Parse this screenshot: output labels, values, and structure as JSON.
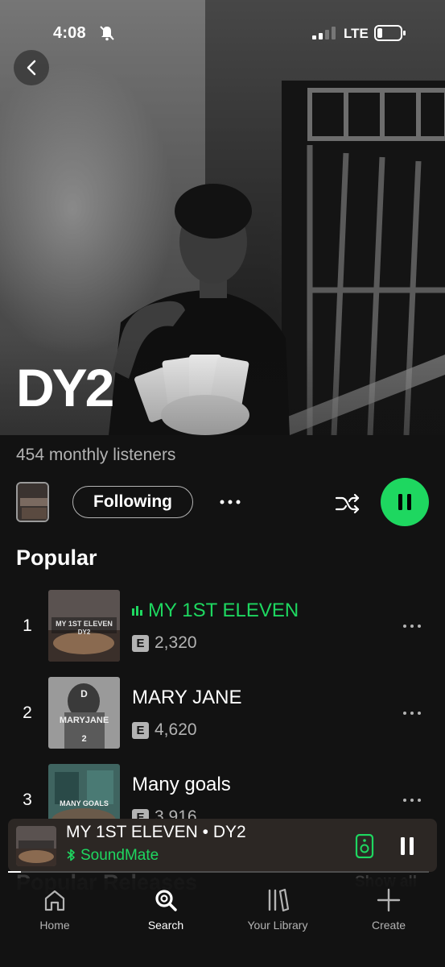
{
  "status_bar": {
    "time": "4:08",
    "network": "LTE"
  },
  "artist": {
    "name": "DY2",
    "monthly_listeners": "454 monthly listeners",
    "follow_label": "Following"
  },
  "popular": {
    "title": "Popular",
    "tracks": [
      {
        "number": "1",
        "title": "MY 1ST ELEVEN",
        "explicit": "E",
        "plays": "2,320",
        "playing": true,
        "cover_text": "MY 1ST ELEVEN DY2"
      },
      {
        "number": "2",
        "title": "MARY JANE",
        "explicit": "E",
        "plays": "4,620",
        "playing": false,
        "cover_text": "D MARYJANE 2"
      },
      {
        "number": "3",
        "title": "Many goals",
        "explicit": "E",
        "plays": "3,916",
        "playing": false,
        "cover_text": "MANY GOALS"
      }
    ]
  },
  "popular_releases": {
    "title": "Popular Releases",
    "show_all": "Show all"
  },
  "mini_player": {
    "title": "MY 1ST ELEVEN • DY2",
    "device": "SoundMate",
    "progress": 0.03
  },
  "nav": {
    "items": [
      {
        "label": "Home",
        "icon": "home-icon"
      },
      {
        "label": "Search",
        "icon": "search-icon",
        "active": true
      },
      {
        "label": "Your Library",
        "icon": "library-icon"
      },
      {
        "label": "Create",
        "icon": "plus-icon"
      }
    ]
  },
  "colors": {
    "accent": "#1ed760",
    "background": "#121212",
    "mini_player_bg": "#2c2724"
  }
}
